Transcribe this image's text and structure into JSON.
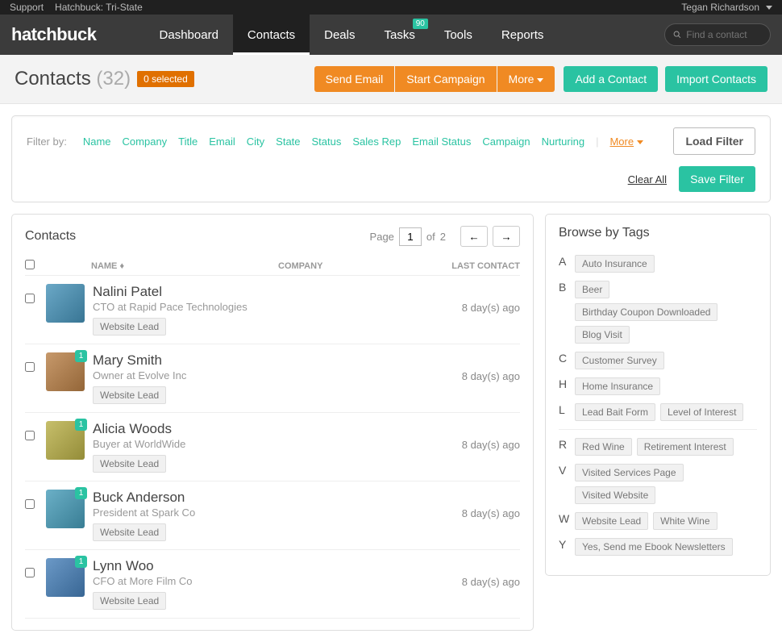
{
  "topbar": {
    "support": "Support",
    "org": "Hatchbuck: Tri-State",
    "user": "Tegan Richardson"
  },
  "logo": "hatchbuck",
  "nav": [
    {
      "label": "Dashboard"
    },
    {
      "label": "Contacts",
      "active": true
    },
    {
      "label": "Deals"
    },
    {
      "label": "Tasks",
      "badge": "90"
    },
    {
      "label": "Tools"
    },
    {
      "label": "Reports"
    }
  ],
  "search": {
    "placeholder": "Find a contact"
  },
  "page": {
    "title": "Contacts",
    "count": "(32)",
    "selected": "0 selected"
  },
  "actions": {
    "send_email": "Send Email",
    "start_campaign": "Start Campaign",
    "more": "More",
    "add_contact": "Add a Contact",
    "import": "Import Contacts"
  },
  "filter": {
    "label": "Filter by:",
    "links": [
      "Name",
      "Company",
      "Title",
      "Email",
      "City",
      "State",
      "Status",
      "Sales Rep",
      "Email Status",
      "Campaign",
      "Nurturing"
    ],
    "more": "More",
    "load": "Load Filter",
    "clear": "Clear All",
    "save": "Save Filter"
  },
  "contactsPanel": {
    "title": "Contacts",
    "pager": {
      "page_label": "Page",
      "current": "1",
      "of_label": "of",
      "total": "2"
    },
    "cols": {
      "name": "NAME",
      "company": "COMPANY",
      "last": "LAST CONTACT"
    }
  },
  "contacts": [
    {
      "name": "Nalini Patel",
      "title": "CTO at Rapid Pace Technologies",
      "tag": "Website Lead",
      "last": "8 day(s) ago",
      "badge": "",
      "hue": 200
    },
    {
      "name": "Mary Smith",
      "title": "Owner at Evolve Inc",
      "tag": "Website Lead",
      "last": "8 day(s) ago",
      "badge": "1",
      "hue": 30
    },
    {
      "name": "Alicia Woods",
      "title": "Buyer at WorldWide",
      "tag": "Website Lead",
      "last": "8 day(s) ago",
      "badge": "1",
      "hue": 55
    },
    {
      "name": "Buck Anderson",
      "title": "President at Spark Co",
      "tag": "Website Lead",
      "last": "8 day(s) ago",
      "badge": "1",
      "hue": 195
    },
    {
      "name": "Lynn Woo",
      "title": "CFO at More Film Co",
      "tag": "Website Lead",
      "last": "8 day(s) ago",
      "badge": "1",
      "hue": 210
    }
  ],
  "tagsPanel": {
    "title": "Browse by Tags"
  },
  "tags": [
    {
      "letter": "A",
      "pills": [
        "Auto Insurance"
      ]
    },
    {
      "letter": "B",
      "pills": [
        "Beer",
        "Birthday Coupon Downloaded",
        "Blog Visit"
      ]
    },
    {
      "letter": "C",
      "pills": [
        "Customer Survey"
      ]
    },
    {
      "letter": "H",
      "pills": [
        "Home Insurance"
      ]
    },
    {
      "letter": "L",
      "pills": [
        "Lead Bait Form",
        "Level of Interest"
      ]
    },
    {
      "letter": "R",
      "pills": [
        "Red Wine",
        "Retirement Interest"
      ],
      "gap": true
    },
    {
      "letter": "V",
      "pills": [
        "Visited Services Page",
        "Visited Website"
      ]
    },
    {
      "letter": "W",
      "pills": [
        "Website Lead",
        "White Wine"
      ]
    },
    {
      "letter": "Y",
      "pills": [
        "Yes, Send me Ebook Newsletters"
      ]
    }
  ]
}
